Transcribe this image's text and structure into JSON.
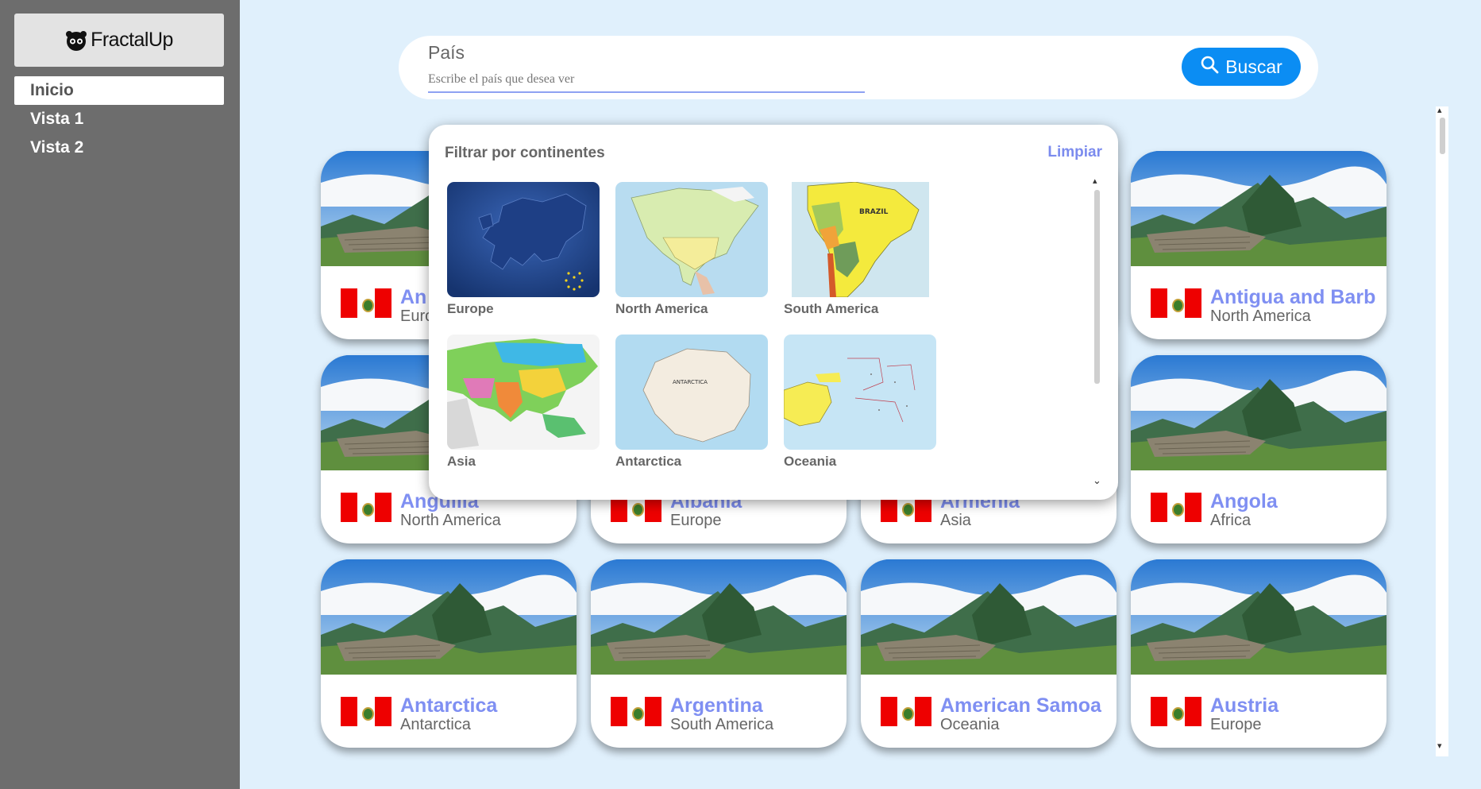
{
  "sidebar": {
    "logo_text": "FractalUp",
    "items": [
      {
        "label": "Inicio",
        "active": true
      },
      {
        "label": "Vista 1",
        "active": false
      },
      {
        "label": "Vista 2",
        "active": false
      }
    ]
  },
  "search": {
    "label": "País",
    "placeholder": "Escribe el país que desea ver",
    "value": "",
    "button_label": "Buscar",
    "button_icon": "search-icon"
  },
  "filter": {
    "title": "Filtrar por continentes",
    "clear_label": "Limpiar",
    "continents": [
      {
        "label": "Europe"
      },
      {
        "label": "North America"
      },
      {
        "label": "South America"
      },
      {
        "label": "Asia"
      },
      {
        "label": "Antarctica"
      },
      {
        "label": "Oceania"
      }
    ]
  },
  "countries": [
    {
      "name": "An",
      "continent": "Euro"
    },
    {
      "name": "",
      "continent": ""
    },
    {
      "name": "",
      "continent": ""
    },
    {
      "name": "Antigua and Barb",
      "continent": "North America"
    },
    {
      "name": "Anguilla",
      "continent": "North America"
    },
    {
      "name": "Albania",
      "continent": "Europe"
    },
    {
      "name": "Armenia",
      "continent": "Asia"
    },
    {
      "name": "Angola",
      "continent": "Africa"
    },
    {
      "name": "Antarctica",
      "continent": "Antarctica"
    },
    {
      "name": "Argentina",
      "continent": "South America"
    },
    {
      "name": "American Samoa",
      "continent": "Oceania"
    },
    {
      "name": "Austria",
      "continent": "Europe"
    }
  ],
  "colors": {
    "accent": "#0b8df3",
    "country_name": "#7f8ff2",
    "sidebar_bg": "#6d6d6d",
    "page_bg": "#e0f0fc"
  }
}
